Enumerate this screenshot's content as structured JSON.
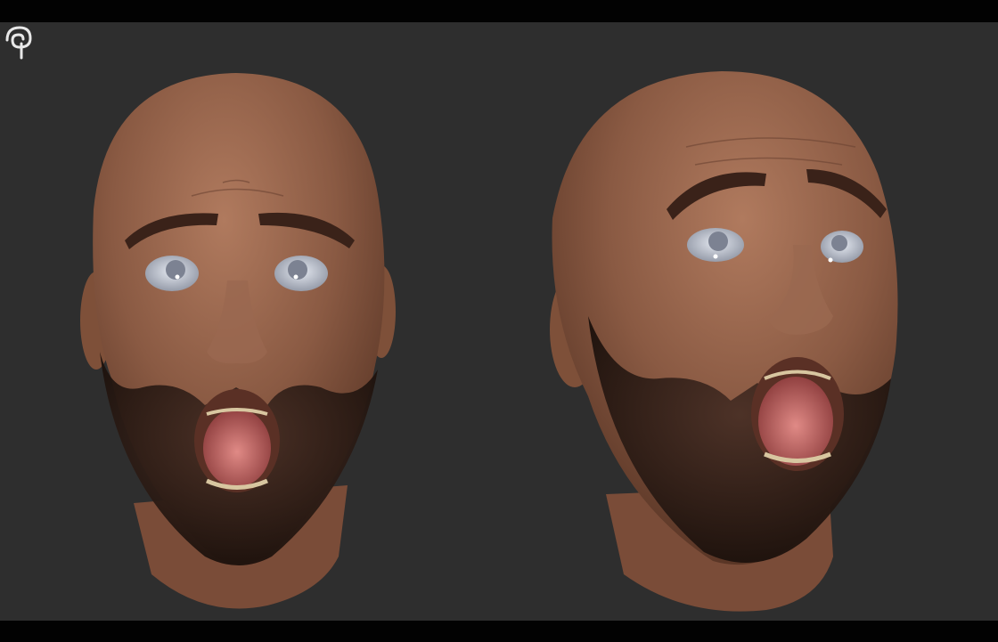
{
  "scene": {
    "background": "#2e2e2e",
    "letterbox": "#020202",
    "skin_color": "#8a5a43",
    "skin_highlight": "#b07a5e",
    "beard_color": "#2a1a14",
    "mouth_color": "#c4666a",
    "eye_color": "#c9ced9",
    "subjects": [
      "front-view-head",
      "three-quarter-view-head"
    ]
  },
  "logo": {
    "icon": "artist-signature-icon",
    "color": "#e8e8e8"
  }
}
